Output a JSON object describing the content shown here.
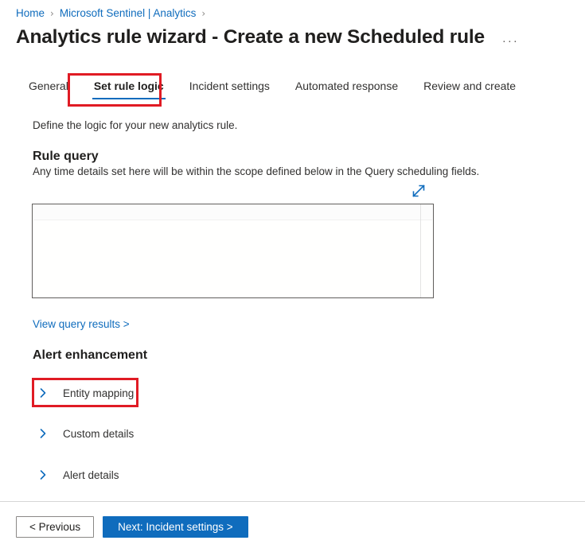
{
  "breadcrumb": {
    "items": [
      {
        "label": "Home"
      },
      {
        "label": "Microsoft Sentinel | Analytics"
      }
    ],
    "separator": "›"
  },
  "header": {
    "title": "Analytics rule wizard - Create a new Scheduled rule",
    "more_menu": "···"
  },
  "tabs": [
    {
      "label": "General",
      "selected": false
    },
    {
      "label": "Set rule logic",
      "selected": true
    },
    {
      "label": "Incident settings",
      "selected": false
    },
    {
      "label": "Automated response",
      "selected": false
    },
    {
      "label": "Review and create",
      "selected": false
    }
  ],
  "main": {
    "intro": "Define the logic for your new analytics rule.",
    "rule_query": {
      "heading": "Rule query",
      "subtext": "Any time details set here will be within the scope defined below in the Query scheduling fields.",
      "editor_value": "",
      "expand_icon": "expand-diagonal-icon"
    },
    "view_query_results": "View query results >",
    "alert_enhancement": {
      "heading": "Alert enhancement",
      "sections": [
        {
          "label": "Entity mapping",
          "expanded": false,
          "icon": "chevron-right-icon"
        },
        {
          "label": "Custom details",
          "expanded": false,
          "icon": "chevron-right-icon"
        },
        {
          "label": "Alert details",
          "expanded": false,
          "icon": "chevron-right-icon"
        }
      ]
    }
  },
  "footer": {
    "previous_label": "< Previous",
    "next_label": "Next: Incident settings >"
  },
  "annotations": {
    "highlight_color": "#e01b24",
    "targets": [
      "Set rule logic",
      "Entity mapping"
    ]
  },
  "colors": {
    "link": "#0f6cbd",
    "accent": "#0f6cbd",
    "text": "#323130",
    "annotation": "#e01b24"
  }
}
